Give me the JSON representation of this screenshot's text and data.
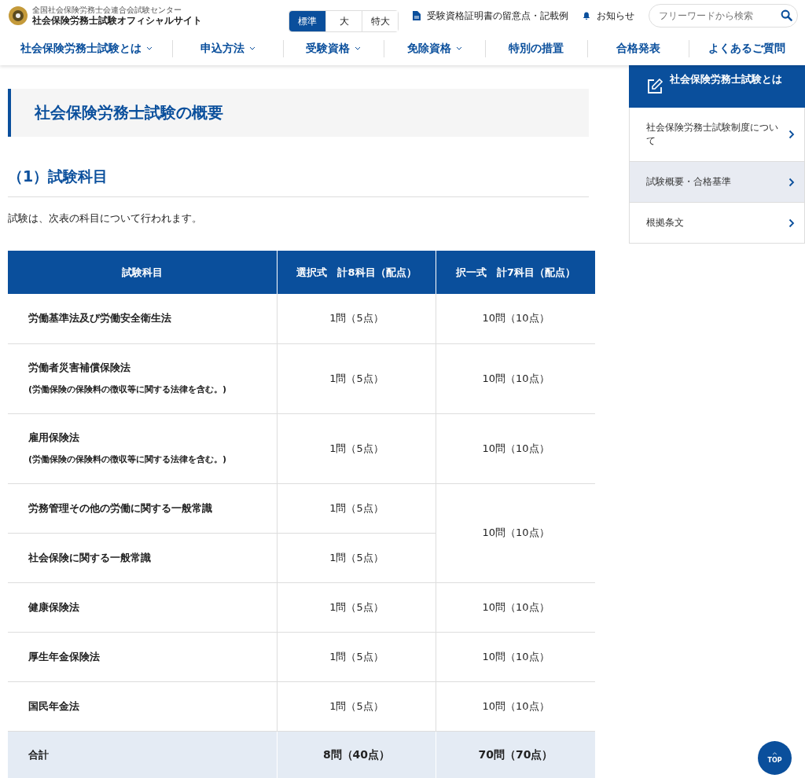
{
  "header": {
    "org_name": "全国社会保険労務士会連合会試験センター",
    "site_title": "社会保険労務士試験オフィシャルサイト",
    "font_sizes": [
      {
        "label": "標準",
        "selected": true
      },
      {
        "label": "大",
        "selected": false
      },
      {
        "label": "特大",
        "selected": false
      }
    ],
    "links": [
      {
        "label": "受験資格証明書の留意点・記載例",
        "kind": "document"
      },
      {
        "label": "お知らせ",
        "kind": "bell"
      }
    ],
    "search": {
      "placeholder": "フリーワードから検索"
    }
  },
  "nav": [
    {
      "label": "社会保険労務士試験とは",
      "dropdown": true
    },
    {
      "label": "申込方法",
      "dropdown": true
    },
    {
      "label": "受験資格",
      "dropdown": true
    },
    {
      "label": "免除資格",
      "dropdown": true
    },
    {
      "label": "特別の措置",
      "dropdown": false
    },
    {
      "label": "合格発表",
      "dropdown": false
    },
    {
      "label": "よくあるご質問",
      "dropdown": false
    }
  ],
  "main": {
    "title": "社会保険労務士試験の概要",
    "section_heading": "（1）試験科目",
    "intro": "試験は、次表の科目について行われます。",
    "table": {
      "columns": [
        "試験科目",
        "選択式　計8科目（配点）",
        "択一式　計7科目（配点）"
      ],
      "rows": [
        {
          "kind": "subject",
          "subject": "労働基準法及び労働安全衛生法",
          "choice": "1問（5点）",
          "multiple": "10問（10点）"
        },
        {
          "kind": "subject",
          "subject": "労働者災害補償保険法",
          "note": "(労働保険の保険料の徴収等に関する法律を含む。)",
          "choice": "1問（5点）",
          "multiple": "10問（10点）"
        },
        {
          "kind": "subject",
          "subject": "雇用保険法",
          "note": "(労働保険の保険料の徴収等に関する法律を含む。)",
          "choice": "1問（5点）",
          "multiple": "10問（10点）"
        },
        {
          "kind": "subject",
          "subject": "労務管理その他の労働に関する一般常識",
          "choice": "1問（5点）",
          "multiple": "10問（10点）"
        },
        {
          "kind": "subject",
          "subject": "社会保険に関する一般常識",
          "choice": "1問（5点）"
        },
        {
          "kind": "subject",
          "subject": "健康保険法",
          "choice": "1問（5点）",
          "multiple": "10問（10点）"
        },
        {
          "kind": "subject",
          "subject": "厚生年金保険法",
          "choice": "1問（5点）",
          "multiple": "10問（10点）"
        },
        {
          "kind": "subject",
          "subject": "国民年金法",
          "choice": "1問（5点）",
          "multiple": "10問（10点）"
        },
        {
          "kind": "total",
          "subject": "合計",
          "choice": "8問（40点）",
          "multiple": "70問（70点）"
        }
      ]
    }
  },
  "sidebar": {
    "heading": "社会保険労務士試験とは",
    "items": [
      {
        "label": "社会保険労務士試験制度について",
        "selected": false
      },
      {
        "label": "試験概要・合格基準",
        "selected": true
      },
      {
        "label": "根拠条文",
        "selected": false
      }
    ]
  },
  "top_button": {
    "label": "TOP"
  }
}
